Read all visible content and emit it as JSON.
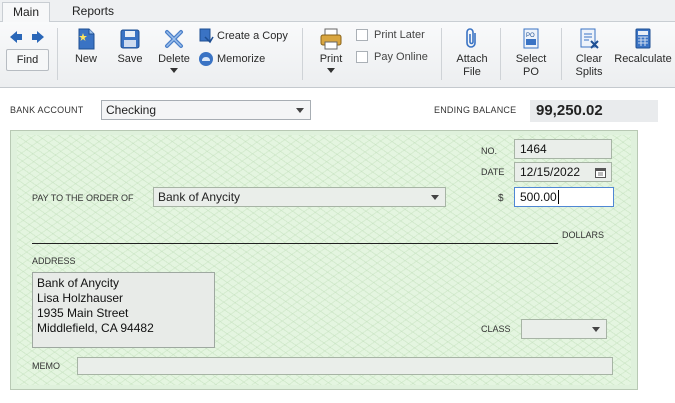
{
  "tabs": [
    {
      "label": "Main"
    },
    {
      "label": "Reports"
    }
  ],
  "ribbon": {
    "find": "Find",
    "new": "New",
    "save": "Save",
    "delete": "Delete",
    "create_copy": "Create a Copy",
    "memorize": "Memorize",
    "print": "Print",
    "print_later": "Print Later",
    "pay_online": "Pay Online",
    "attach_file_1": "Attach",
    "attach_file_2": "File",
    "select_po_1": "Select",
    "select_po_2": "PO",
    "clear_splits_1": "Clear",
    "clear_splits_2": "Splits",
    "recalculate": "Recalculate"
  },
  "account": {
    "bank_account_label": "BANK ACCOUNT",
    "bank_account_value": "Checking",
    "ending_balance_label": "ENDING BALANCE",
    "ending_balance_value": "99,250.02"
  },
  "check": {
    "no_label": "NO.",
    "no_value": "1464",
    "date_label": "DATE",
    "date_value": "12/15/2022",
    "pay_to_label": "PAY TO THE ORDER OF",
    "pay_to_value": "Bank of Anycity",
    "dollar_sign": "$",
    "amount_value": "500.00",
    "dollars_label": "DOLLARS",
    "address_label": "ADDRESS",
    "address_lines": [
      "Bank of Anycity",
      "Lisa Holzhauser",
      "1935 Main Street",
      "Middlefield, CA 94482"
    ],
    "class_label": "CLASS",
    "class_value": "",
    "memo_label": "MEMO",
    "memo_value": ""
  }
}
